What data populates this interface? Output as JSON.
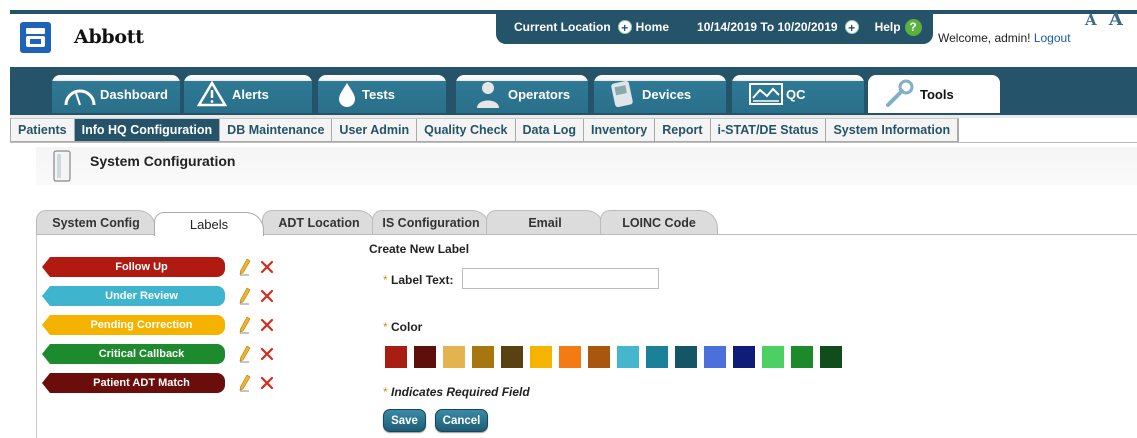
{
  "brand": {
    "name": "Abbott"
  },
  "location_bar": {
    "current_location_label": "Current Location",
    "location_value": "Home",
    "date_range": "10/14/2019 To 10/20/2019",
    "help_label": "Help",
    "help_icon": "?"
  },
  "user": {
    "welcome_text": "Welcome, admin!",
    "logout_label": "Logout"
  },
  "font_size_controls": {
    "decrease": "A",
    "increase": "A"
  },
  "main_tabs": [
    {
      "label": "Dashboard",
      "icon": "gauge-icon"
    },
    {
      "label": "Alerts",
      "icon": "warning-icon"
    },
    {
      "label": "Tests",
      "icon": "droplet-icon"
    },
    {
      "label": "Operators",
      "icon": "person-icon"
    },
    {
      "label": "Devices",
      "icon": "device-icon"
    },
    {
      "label": "QC",
      "icon": "qc-chart-icon"
    },
    {
      "label": "Tools",
      "icon": "wrench-icon",
      "active": true
    }
  ],
  "sub_nav": [
    "Patients",
    "Info HQ Configuration",
    "DB Maintenance",
    "User Admin",
    "Quality Check",
    "Data Log",
    "Inventory",
    "Report",
    "i-STAT/DE Status",
    "System Information"
  ],
  "sub_nav_active": "Info HQ Configuration",
  "page_title": "System Configuration",
  "config_tabs": [
    {
      "label": "System Config"
    },
    {
      "label": "Labels",
      "active": true
    },
    {
      "label": "ADT Location"
    },
    {
      "label": "IS Configuration"
    },
    {
      "label": "Email"
    },
    {
      "label": "LOINC Code"
    }
  ],
  "labels": [
    {
      "text": "Follow Up",
      "color": "#b01a10"
    },
    {
      "text": "Under Review",
      "color": "#3fb4cf"
    },
    {
      "text": "Pending Correction",
      "color": "#f5b300"
    },
    {
      "text": "Critical Callback",
      "color": "#1e8a2e"
    },
    {
      "text": "Patient ADT Match",
      "color": "#6b0e0b"
    }
  ],
  "create_form": {
    "title": "Create New Label",
    "required_mark": "*",
    "label_text_label": "Label Text:",
    "label_text_value": "",
    "color_label": "Color",
    "colors": [
      "#a81e12",
      "#5e0f0c",
      "#e4b24e",
      "#a8760f",
      "#5a4112",
      "#f6b400",
      "#f47b14",
      "#a9570f",
      "#46b6cf",
      "#1a8199",
      "#145566",
      "#4c6fdc",
      "#0f1c78",
      "#4ccf63",
      "#1c8a2b",
      "#114d1a"
    ],
    "required_note": "Indicates Required Field",
    "save_label": "Save",
    "cancel_label": "Cancel"
  }
}
